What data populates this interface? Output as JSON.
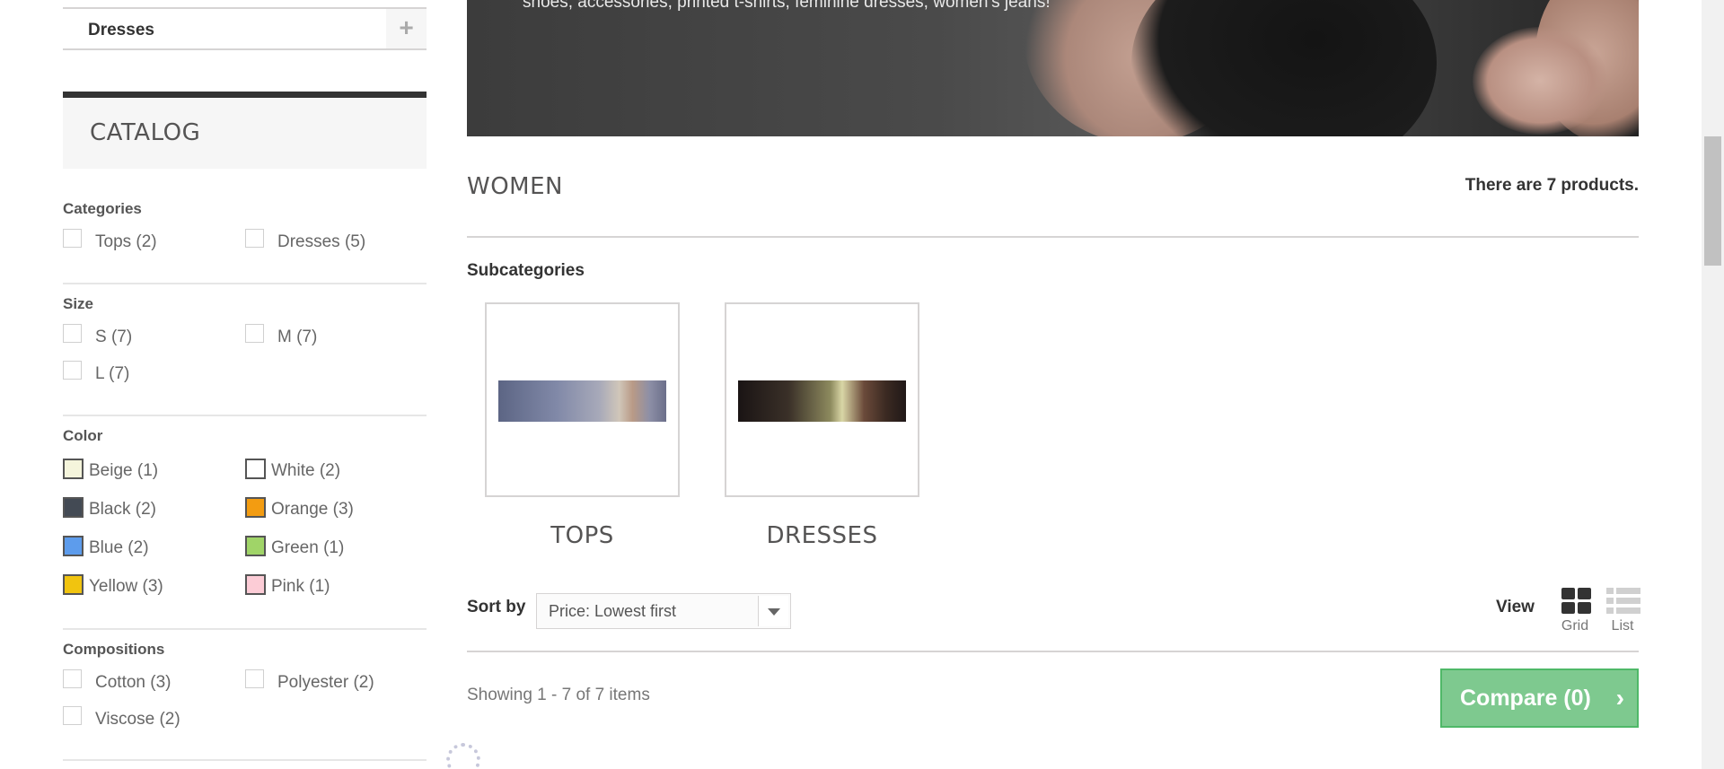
{
  "sidebar": {
    "dresses_category": "Dresses",
    "expand_symbol": "+",
    "catalog_title": "CATALOG",
    "categories": {
      "title": "Categories",
      "options": [
        "Tops (2)",
        "Dresses (5)"
      ]
    },
    "size": {
      "title": "Size",
      "options": [
        "S (7)",
        "M (7)",
        "L (7)"
      ]
    },
    "color": {
      "title": "Color",
      "options": [
        {
          "label": "Beige (1)",
          "color": "#f5f5dc"
        },
        {
          "label": "White (2)",
          "color": "#ffffff"
        },
        {
          "label": "Black (2)",
          "color": "#434a54"
        },
        {
          "label": "Orange (3)",
          "color": "#f39c11"
        },
        {
          "label": "Blue (2)",
          "color": "#5d9cec"
        },
        {
          "label": "Green (1)",
          "color": "#a0d468"
        },
        {
          "label": "Yellow (3)",
          "color": "#f1c40f"
        },
        {
          "label": "Pink (1)",
          "color": "#fcccd6"
        }
      ]
    },
    "compositions": {
      "title": "Compositions",
      "options": [
        "Cotton (3)",
        "Polyester (2)",
        "Viscose (2)"
      ]
    }
  },
  "hero": {
    "caption": "shoes, accessories, printed t-shirts, feminine dresses, women's jeans!"
  },
  "main": {
    "category_title": "WOMEN",
    "product_count": "There are 7 products.",
    "subcategories_title": "Subcategories",
    "subcategories": [
      {
        "name": "TOPS"
      },
      {
        "name": "DRESSES"
      }
    ],
    "sort_label": "Sort by",
    "sort_value": "Price: Lowest first",
    "view_label": "View",
    "view_grid": "Grid",
    "view_list": "List",
    "showing": "Showing 1 - 7 of 7 items",
    "compare_button": "Compare (0)",
    "compare_chevron": "›"
  },
  "colors": {
    "accent_green": "#7ec98f",
    "dark_bar": "#333333"
  }
}
